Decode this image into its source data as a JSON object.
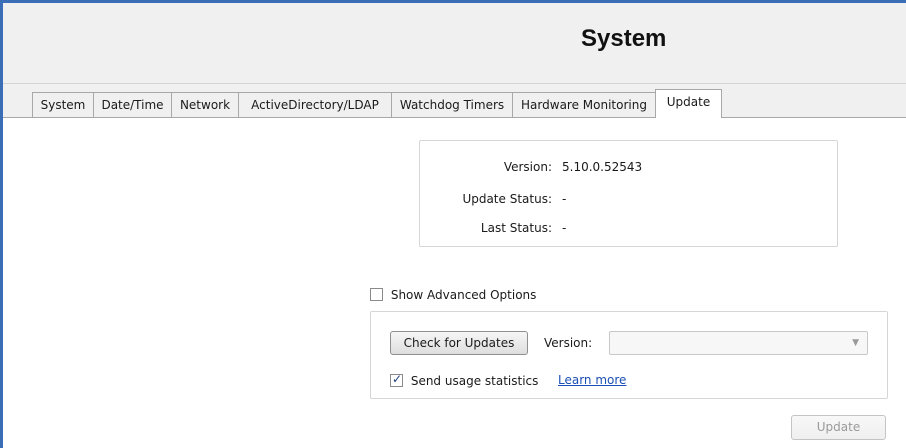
{
  "header": {
    "title": "System"
  },
  "tabs": [
    {
      "label": "System"
    },
    {
      "label": "Date/Time"
    },
    {
      "label": "Network"
    },
    {
      "label": "ActiveDirectory/LDAP"
    },
    {
      "label": "Watchdog Timers"
    },
    {
      "label": "Hardware Monitoring"
    },
    {
      "label": "Update",
      "active": true
    }
  ],
  "info": {
    "version_label": "Version:",
    "version_value": "5.10.0.52543",
    "update_status_label": "Update Status:",
    "update_status_value": "-",
    "last_status_label": "Last Status:",
    "last_status_value": "-"
  },
  "advanced": {
    "show_label": "Show Advanced Options",
    "show_checked": false
  },
  "options": {
    "check_button": "Check for Updates",
    "version_label": "Version:",
    "version_selected": "",
    "usage_label": "Send usage statistics",
    "usage_checked": true,
    "learn_more": "Learn more"
  },
  "footer": {
    "update_button": "Update"
  },
  "colors": {
    "accent": "#3a6fb7",
    "link": "#1c4fb3"
  }
}
